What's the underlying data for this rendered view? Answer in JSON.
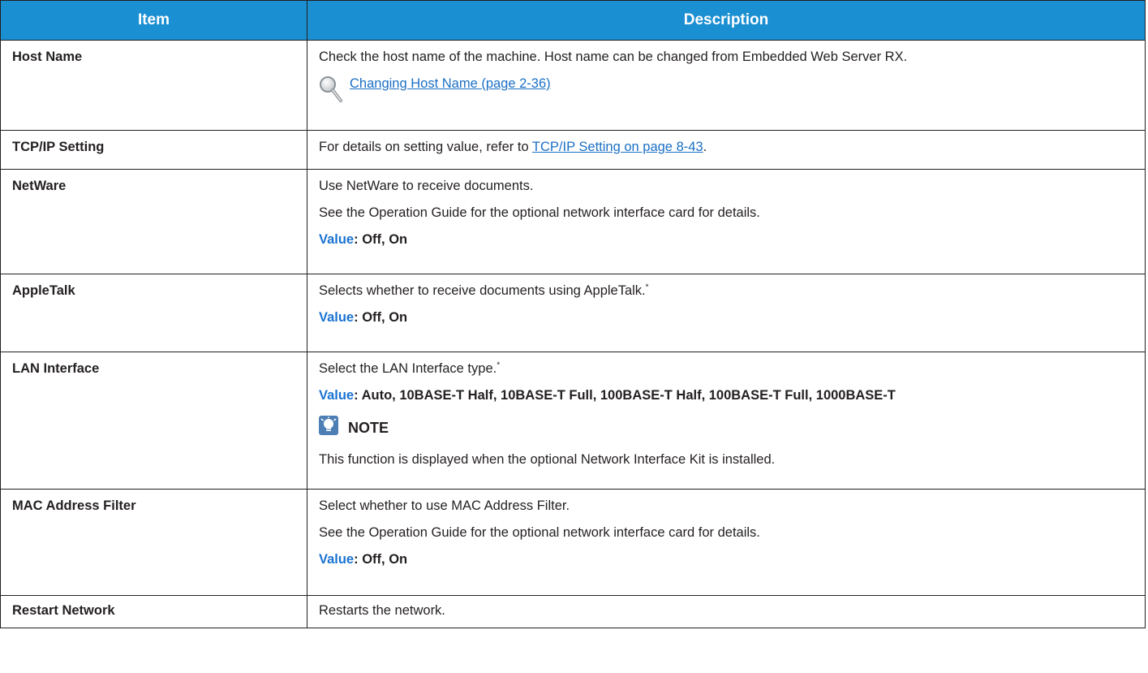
{
  "header": {
    "item": "Item",
    "description": "Description"
  },
  "rows": [
    {
      "item": "Host Name",
      "text1": "Check the host name of the machine. Host name can be changed from Embedded Web Server RX.",
      "link": "Changing Host Name (page 2-36)"
    },
    {
      "item": "TCP/IP Setting",
      "text_before": "For details on setting value, refer to ",
      "link": "TCP/IP Setting on page 8-43",
      "text_after": "."
    },
    {
      "item": "NetWare",
      "text1": "Use NetWare to receive documents.",
      "text2": "See the Operation Guide for the optional network interface card for details.",
      "value_label": "Value",
      "value": ": Off, On"
    },
    {
      "item": "AppleTalk",
      "text1": "Selects whether to receive documents using AppleTalk.",
      "footnote": "*",
      "value_label": "Value",
      "value": ": Off, On"
    },
    {
      "item": "LAN Interface",
      "text1": "Select the LAN Interface type.",
      "footnote": "*",
      "value_label": "Value",
      "value": ": Auto, 10BASE-T Half, 10BASE-T Full, 100BASE-T Half, 100BASE-T Full, 1000BASE-T",
      "note_title": "NOTE",
      "note_text": "This function is displayed when the optional Network Interface Kit is installed."
    },
    {
      "item": "MAC Address Filter",
      "text1": "Select whether to use MAC Address Filter.",
      "text2": "See the Operation Guide for the optional network interface card for details.",
      "value_label": "Value",
      "value": ": Off, On"
    },
    {
      "item": "Restart Network",
      "text1": "Restarts the network."
    }
  ],
  "colors": {
    "header_bg": "#1a8fd2",
    "link": "#1a6fc4",
    "value_label": "#1a73d1"
  },
  "icons": [
    "magnifier-icon",
    "note-lightbulb-icon"
  ]
}
